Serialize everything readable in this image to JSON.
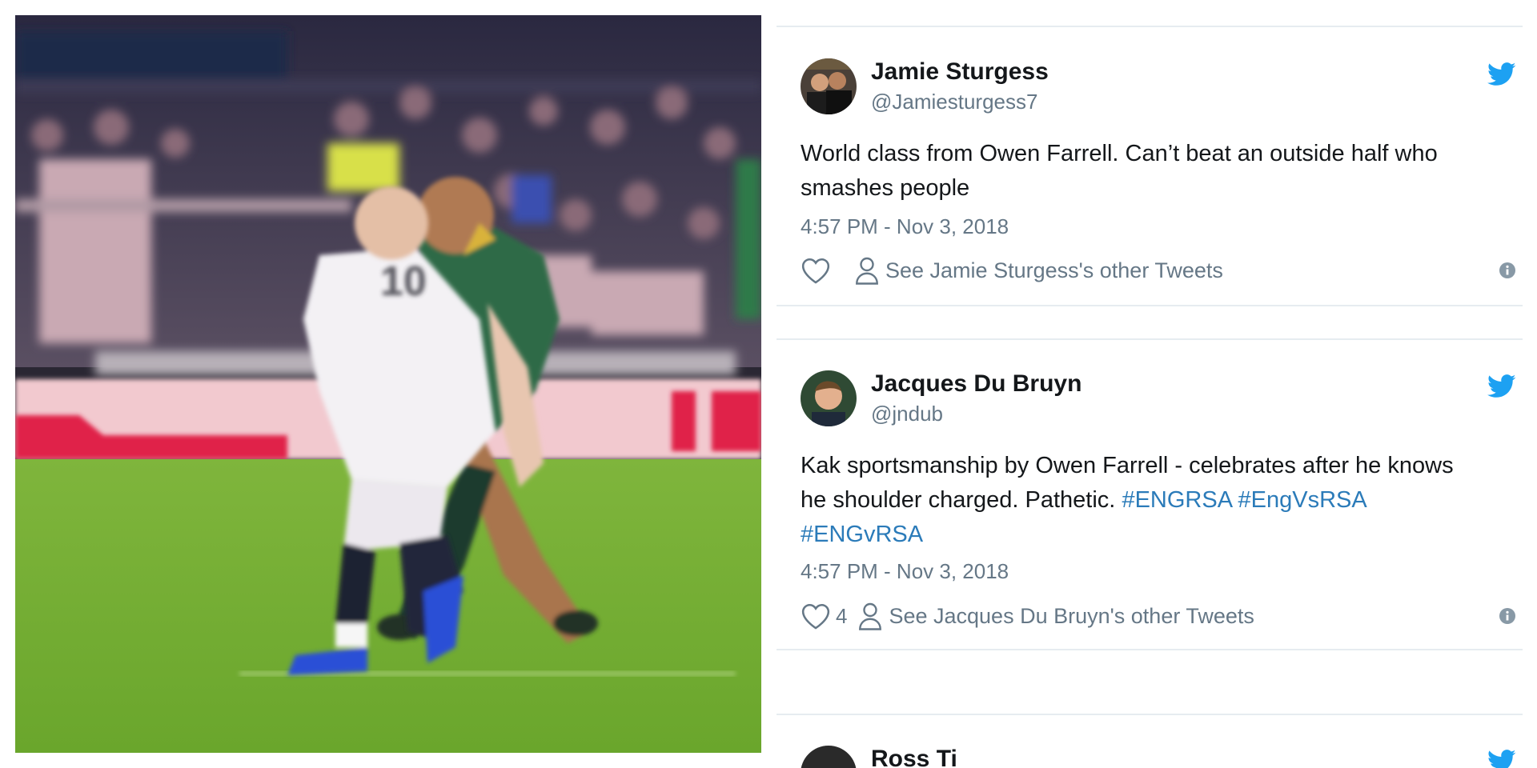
{
  "video": {
    "jersey_number": "10"
  },
  "tweets": [
    {
      "author_name": "Jamie Sturgess",
      "handle": "@Jamiesturgess7",
      "text_lines": [
        "World class from Owen Farrell. Can’t beat an outside half who",
        "smashes people"
      ],
      "time": "4:57 PM - Nov 3, 2018",
      "like_count": "",
      "see_other": "See Jamie Sturgess's other Tweets"
    },
    {
      "author_name": "Jacques Du Bruyn",
      "handle": "@jndub",
      "text_line1": "Kak sportsmanship by Owen Farrell - celebrates after he knows",
      "text_line2": "he shoulder charged. Pathetic.",
      "hashtags": [
        "#ENGRSA",
        "#EngVsRSA",
        "#ENGvRSA"
      ],
      "time": "4:57 PM - Nov 3, 2018",
      "like_count": "4",
      "see_other": "See Jacques Du Bruyn's other Tweets"
    },
    {
      "author_name": "Ross Ti",
      "handle": ""
    }
  ],
  "colors": {
    "twitter_blue": "#1da1f2",
    "hashtag_blue": "#2b7bb9",
    "secondary_text": "#657786",
    "divider": "#e6ecf0"
  },
  "icons": [
    "twitter-bird-icon",
    "heart-icon",
    "person-icon",
    "info-icon"
  ]
}
